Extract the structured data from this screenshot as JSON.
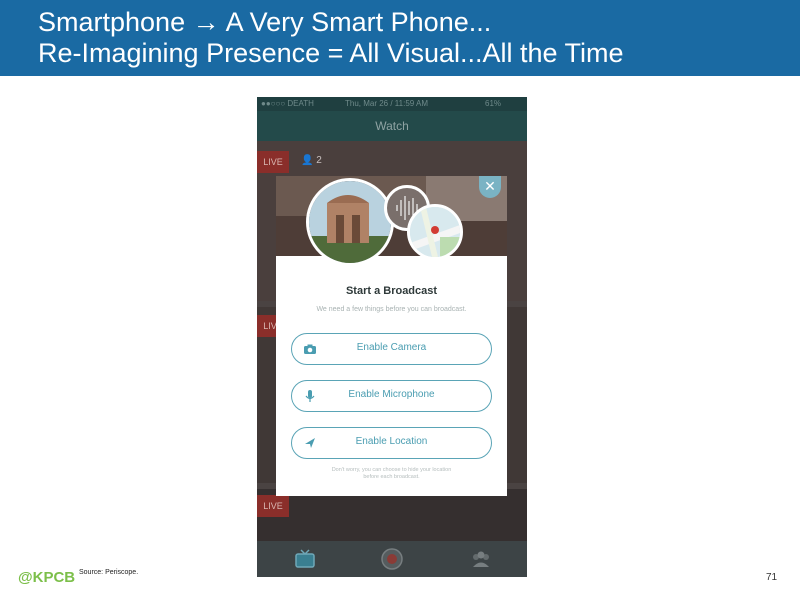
{
  "slide": {
    "title_line1": "Smartphone → A Very Smart Phone...",
    "title_line2": "Re-Imagining Presence = All Visual...All the Time",
    "source": "Source: Periscope.",
    "page_number": "71",
    "logo": "@KPCB",
    "colors": {
      "title_bar": "#1a6aa3",
      "logo": "#7cbf4a",
      "accent": "#4a9db1"
    }
  },
  "phone": {
    "status": {
      "carrier": "●●○○○ DEATH",
      "time": "Thu, Mar 26 / 11:59 AM",
      "battery": "61%"
    },
    "nav_title": "Watch",
    "feed": {
      "live_label": "LIVE",
      "viewer_count": "2"
    },
    "tabs": [
      {
        "icon": "tv-icon"
      },
      {
        "icon": "camera-record-icon"
      },
      {
        "icon": "people-icon"
      }
    ]
  },
  "modal": {
    "title": "Start a Broadcast",
    "subtitle": "We need a few things before you can broadcast.",
    "close_icon": "close-icon",
    "buttons": [
      {
        "label": "Enable Camera",
        "icon": "camera-icon"
      },
      {
        "label": "Enable Microphone",
        "icon": "microphone-icon"
      },
      {
        "label": "Enable Location",
        "icon": "location-arrow-icon"
      }
    ],
    "note_line1": "Don't worry, you can choose to hide your location",
    "note_line2": "before each broadcast."
  }
}
